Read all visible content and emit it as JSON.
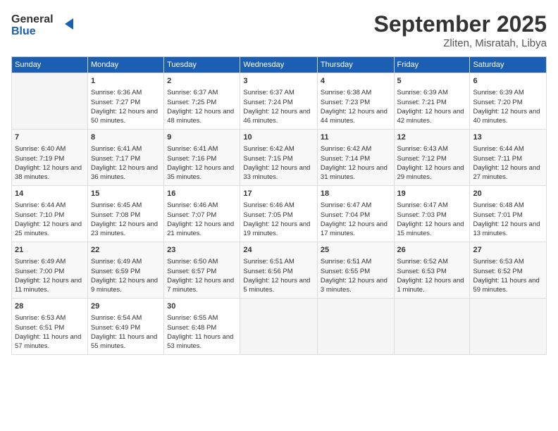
{
  "header": {
    "logo_line1": "General",
    "logo_line2": "Blue",
    "month": "September 2025",
    "location": "Zliten, Misratah, Libya"
  },
  "days_of_week": [
    "Sunday",
    "Monday",
    "Tuesday",
    "Wednesday",
    "Thursday",
    "Friday",
    "Saturday"
  ],
  "weeks": [
    [
      {
        "day": "",
        "empty": true
      },
      {
        "day": "1",
        "sunrise": "Sunrise: 6:36 AM",
        "sunset": "Sunset: 7:27 PM",
        "daylight": "Daylight: 12 hours and 50 minutes."
      },
      {
        "day": "2",
        "sunrise": "Sunrise: 6:37 AM",
        "sunset": "Sunset: 7:25 PM",
        "daylight": "Daylight: 12 hours and 48 minutes."
      },
      {
        "day": "3",
        "sunrise": "Sunrise: 6:37 AM",
        "sunset": "Sunset: 7:24 PM",
        "daylight": "Daylight: 12 hours and 46 minutes."
      },
      {
        "day": "4",
        "sunrise": "Sunrise: 6:38 AM",
        "sunset": "Sunset: 7:23 PM",
        "daylight": "Daylight: 12 hours and 44 minutes."
      },
      {
        "day": "5",
        "sunrise": "Sunrise: 6:39 AM",
        "sunset": "Sunset: 7:21 PM",
        "daylight": "Daylight: 12 hours and 42 minutes."
      },
      {
        "day": "6",
        "sunrise": "Sunrise: 6:39 AM",
        "sunset": "Sunset: 7:20 PM",
        "daylight": "Daylight: 12 hours and 40 minutes."
      }
    ],
    [
      {
        "day": "7",
        "sunrise": "Sunrise: 6:40 AM",
        "sunset": "Sunset: 7:19 PM",
        "daylight": "Daylight: 12 hours and 38 minutes."
      },
      {
        "day": "8",
        "sunrise": "Sunrise: 6:41 AM",
        "sunset": "Sunset: 7:17 PM",
        "daylight": "Daylight: 12 hours and 36 minutes."
      },
      {
        "day": "9",
        "sunrise": "Sunrise: 6:41 AM",
        "sunset": "Sunset: 7:16 PM",
        "daylight": "Daylight: 12 hours and 35 minutes."
      },
      {
        "day": "10",
        "sunrise": "Sunrise: 6:42 AM",
        "sunset": "Sunset: 7:15 PM",
        "daylight": "Daylight: 12 hours and 33 minutes."
      },
      {
        "day": "11",
        "sunrise": "Sunrise: 6:42 AM",
        "sunset": "Sunset: 7:14 PM",
        "daylight": "Daylight: 12 hours and 31 minutes."
      },
      {
        "day": "12",
        "sunrise": "Sunrise: 6:43 AM",
        "sunset": "Sunset: 7:12 PM",
        "daylight": "Daylight: 12 hours and 29 minutes."
      },
      {
        "day": "13",
        "sunrise": "Sunrise: 6:44 AM",
        "sunset": "Sunset: 7:11 PM",
        "daylight": "Daylight: 12 hours and 27 minutes."
      }
    ],
    [
      {
        "day": "14",
        "sunrise": "Sunrise: 6:44 AM",
        "sunset": "Sunset: 7:10 PM",
        "daylight": "Daylight: 12 hours and 25 minutes."
      },
      {
        "day": "15",
        "sunrise": "Sunrise: 6:45 AM",
        "sunset": "Sunset: 7:08 PM",
        "daylight": "Daylight: 12 hours and 23 minutes."
      },
      {
        "day": "16",
        "sunrise": "Sunrise: 6:46 AM",
        "sunset": "Sunset: 7:07 PM",
        "daylight": "Daylight: 12 hours and 21 minutes."
      },
      {
        "day": "17",
        "sunrise": "Sunrise: 6:46 AM",
        "sunset": "Sunset: 7:05 PM",
        "daylight": "Daylight: 12 hours and 19 minutes."
      },
      {
        "day": "18",
        "sunrise": "Sunrise: 6:47 AM",
        "sunset": "Sunset: 7:04 PM",
        "daylight": "Daylight: 12 hours and 17 minutes."
      },
      {
        "day": "19",
        "sunrise": "Sunrise: 6:47 AM",
        "sunset": "Sunset: 7:03 PM",
        "daylight": "Daylight: 12 hours and 15 minutes."
      },
      {
        "day": "20",
        "sunrise": "Sunrise: 6:48 AM",
        "sunset": "Sunset: 7:01 PM",
        "daylight": "Daylight: 12 hours and 13 minutes."
      }
    ],
    [
      {
        "day": "21",
        "sunrise": "Sunrise: 6:49 AM",
        "sunset": "Sunset: 7:00 PM",
        "daylight": "Daylight: 12 hours and 11 minutes."
      },
      {
        "day": "22",
        "sunrise": "Sunrise: 6:49 AM",
        "sunset": "Sunset: 6:59 PM",
        "daylight": "Daylight: 12 hours and 9 minutes."
      },
      {
        "day": "23",
        "sunrise": "Sunrise: 6:50 AM",
        "sunset": "Sunset: 6:57 PM",
        "daylight": "Daylight: 12 hours and 7 minutes."
      },
      {
        "day": "24",
        "sunrise": "Sunrise: 6:51 AM",
        "sunset": "Sunset: 6:56 PM",
        "daylight": "Daylight: 12 hours and 5 minutes."
      },
      {
        "day": "25",
        "sunrise": "Sunrise: 6:51 AM",
        "sunset": "Sunset: 6:55 PM",
        "daylight": "Daylight: 12 hours and 3 minutes."
      },
      {
        "day": "26",
        "sunrise": "Sunrise: 6:52 AM",
        "sunset": "Sunset: 6:53 PM",
        "daylight": "Daylight: 12 hours and 1 minute."
      },
      {
        "day": "27",
        "sunrise": "Sunrise: 6:53 AM",
        "sunset": "Sunset: 6:52 PM",
        "daylight": "Daylight: 11 hours and 59 minutes."
      }
    ],
    [
      {
        "day": "28",
        "sunrise": "Sunrise: 6:53 AM",
        "sunset": "Sunset: 6:51 PM",
        "daylight": "Daylight: 11 hours and 57 minutes."
      },
      {
        "day": "29",
        "sunrise": "Sunrise: 6:54 AM",
        "sunset": "Sunset: 6:49 PM",
        "daylight": "Daylight: 11 hours and 55 minutes."
      },
      {
        "day": "30",
        "sunrise": "Sunrise: 6:55 AM",
        "sunset": "Sunset: 6:48 PM",
        "daylight": "Daylight: 11 hours and 53 minutes."
      },
      {
        "day": "",
        "empty": true
      },
      {
        "day": "",
        "empty": true
      },
      {
        "day": "",
        "empty": true
      },
      {
        "day": "",
        "empty": true
      }
    ]
  ]
}
